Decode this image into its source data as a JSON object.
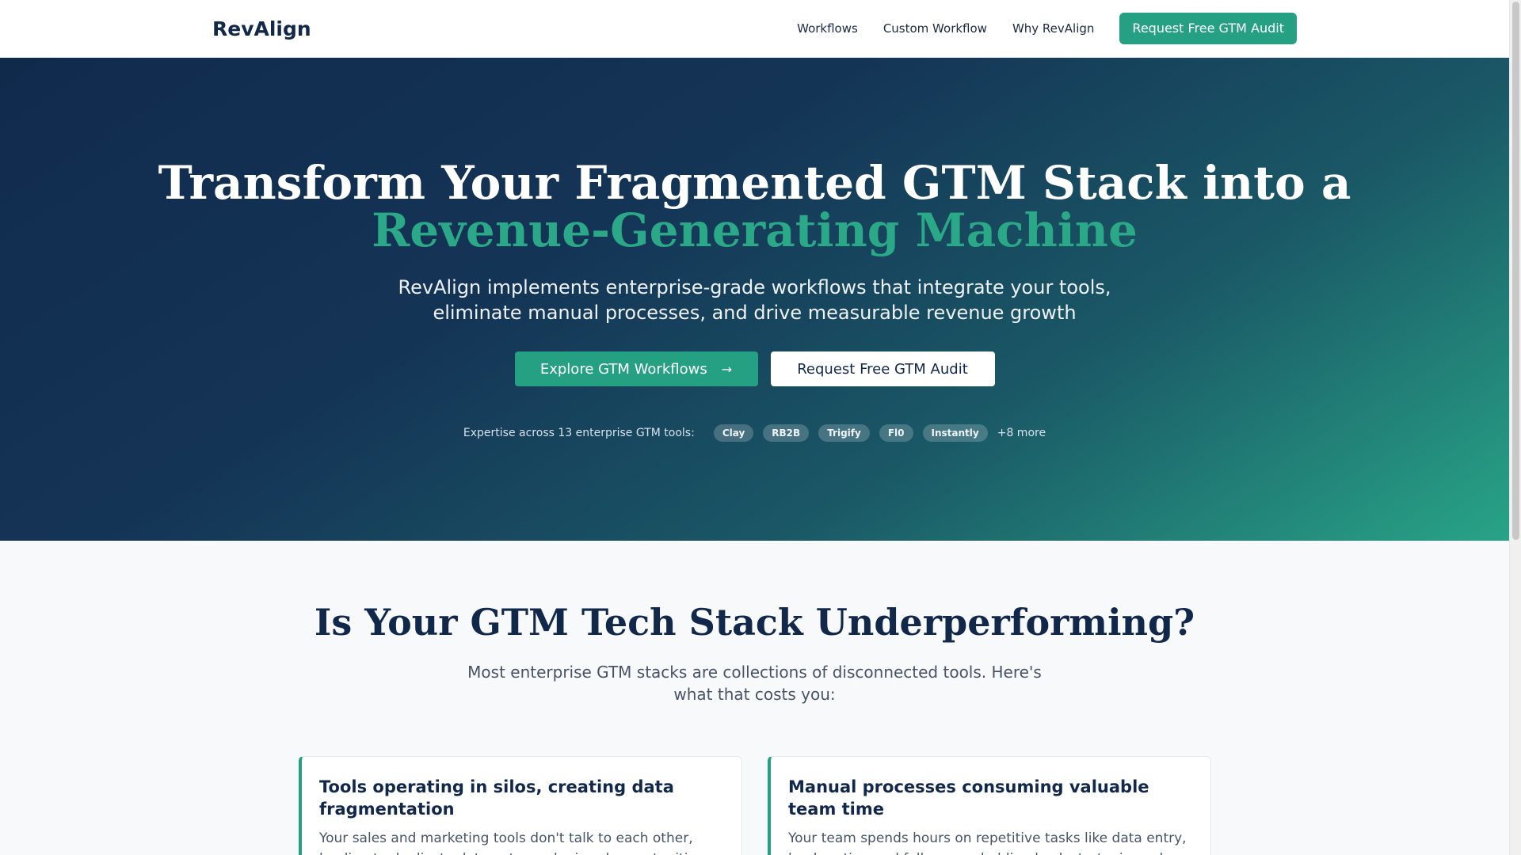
{
  "header": {
    "brand": "RevAlign",
    "nav": [
      "Workflows",
      "Custom Workflow",
      "Why RevAlign"
    ],
    "cta": "Request Free GTM Audit"
  },
  "hero": {
    "title_line1": "Transform Your Fragmented GTM Stack into a",
    "title_accent": "Revenue-Generating Machine",
    "subtitle": "RevAlign implements enterprise-grade workflows that integrate your tools, eliminate manual processes, and drive measurable revenue growth",
    "primary_button": "Explore GTM Workflows",
    "primary_arrow": "→",
    "secondary_button": "Request Free GTM Audit",
    "tools_label": "Expertise across 13 enterprise GTM tools:",
    "tools": [
      "Clay",
      "RB2B",
      "Trigify",
      "Fl0",
      "Instantly"
    ],
    "tools_more": "+8 more"
  },
  "problems": {
    "title": "Is Your GTM Tech Stack Underperforming?",
    "subtitle": "Most enterprise GTM stacks are collections of disconnected tools. Here's what that costs you:",
    "cards": [
      {
        "title": "Tools operating in silos, creating data fragmentation",
        "body": "Your sales and marketing tools don't talk to each other, leading to duplicate data entry and missed opportunities."
      },
      {
        "title": "Manual processes consuming valuable team time",
        "body": "Your team spends hours on repetitive tasks like data entry, lead routing and follow-ups, holding back strategic work."
      }
    ]
  },
  "colors": {
    "accent": "#26a083",
    "navy": "#12284a"
  }
}
